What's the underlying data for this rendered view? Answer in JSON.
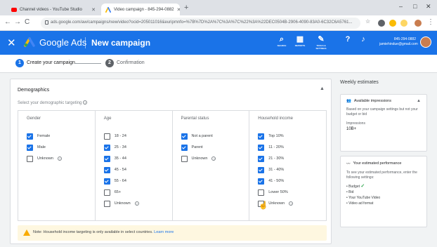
{
  "browser": {
    "tabs": [
      {
        "title": "Channel videos - YouTube Studio"
      },
      {
        "title": "Video campaign - 845-294-0882"
      }
    ],
    "url": "ads.google.com/aw/campaigns/new/video?ocid=205011016&euripmnfo=%7B%7D%2A%7C%3A%7C%22%3A%22DEC0504B-2906-4090-83A0-6C32C6A5761..."
  },
  "ads": {
    "brand": "Google Ads",
    "campaign_title": "New campaign",
    "tools": [
      {
        "label": "SEARCH",
        "icon": "search-icon"
      },
      {
        "label": "REPORTS",
        "icon": "reports-icon"
      },
      {
        "label": "TOOLS & SETTINGS",
        "icon": "wrench-icon"
      }
    ],
    "account_phone": "845-294-0882",
    "account_email": "jamiehindue@gmail.com"
  },
  "steps": [
    {
      "num": "1",
      "label": "Create your campaign",
      "active": true
    },
    {
      "num": "2",
      "label": "Confirmation",
      "active": false
    }
  ],
  "demographics": {
    "title": "Demographics",
    "subtitle": "Select your demographic targeting",
    "columns": [
      {
        "header": "Gender",
        "options": [
          {
            "label": "Female",
            "checked": true
          },
          {
            "label": "Male",
            "checked": true
          },
          {
            "label": "Unknown",
            "checked": false,
            "help": true
          }
        ]
      },
      {
        "header": "Age",
        "options": [
          {
            "label": "18 - 24",
            "checked": false
          },
          {
            "label": "25 - 34",
            "checked": true
          },
          {
            "label": "35 - 44",
            "checked": true
          },
          {
            "label": "45 - 54",
            "checked": true
          },
          {
            "label": "55 - 64",
            "checked": true
          },
          {
            "label": "65+",
            "checked": false
          },
          {
            "label": "Unknown",
            "checked": false,
            "help": true
          }
        ]
      },
      {
        "header": "Parental status",
        "options": [
          {
            "label": "Not a parent",
            "checked": true
          },
          {
            "label": "Parent",
            "checked": true
          },
          {
            "label": "Unknown",
            "checked": false,
            "help": true
          }
        ]
      },
      {
        "header": "Household income",
        "options": [
          {
            "label": "Top 10%",
            "checked": true
          },
          {
            "label": "11 - 20%",
            "checked": true
          },
          {
            "label": "21 - 30%",
            "checked": true
          },
          {
            "label": "31 - 40%",
            "checked": true
          },
          {
            "label": "41 - 50%",
            "checked": true
          },
          {
            "label": "Lower 50%",
            "checked": false
          },
          {
            "label": "Unknown",
            "checked": false,
            "help": true
          }
        ]
      }
    ],
    "note": "Note: Household income targeting is only available in select countries.",
    "note_link": "Learn more"
  },
  "estimates": {
    "title": "Weekly estimates",
    "impressions_title": "Available impressions",
    "impressions_desc": "Based on your campaign settings but not your budget or bid",
    "impressions_label": "Impressions",
    "impressions_value": "10B+",
    "perf_title": "Your estimated performance",
    "perf_desc": "To see your estimated performance, enter the following settings:",
    "perf_items": [
      "Budget",
      "Bid",
      "Your YouTube Video",
      "Video ad format"
    ]
  },
  "colors": {
    "accent": "#1a73e8",
    "note_bg": "#fef7e0",
    "warn": "#f9ab00",
    "check": "#34a853"
  }
}
